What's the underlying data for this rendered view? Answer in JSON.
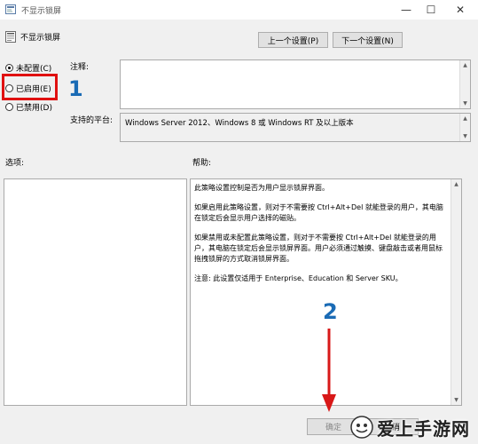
{
  "window": {
    "title": "不显示锁屏",
    "minimize_glyph": "—",
    "maximize_glyph": "☐",
    "close_glyph": "✕"
  },
  "header": {
    "policy_title": "不显示锁屏",
    "prev_button": "上一个设置(P)",
    "next_button": "下一个设置(N)"
  },
  "radios": {
    "not_configured": "未配置(C)",
    "enabled": "已启用(E)",
    "disabled": "已禁用(D)",
    "selected": "not_configured"
  },
  "comment": {
    "label": "注释:",
    "value": ""
  },
  "supported": {
    "label": "支持的平台:",
    "value": "Windows Server 2012、Windows 8 或 Windows RT 及以上版本"
  },
  "options_label": "选项:",
  "help": {
    "label": "帮助:",
    "paragraphs": [
      "此策略设置控制是否为用户显示锁屏界面。",
      "如果启用此策略设置，则对于不需要按 Ctrl+Alt+Del 就能登录的用户，其电脑在锁定后会显示用户选择的磁贴。",
      "如果禁用或未配置此策略设置，则对于不需要按 Ctrl+Alt+Del 就能登录的用户，其电脑在锁定后会显示锁屏界面。用户必须通过触摸、键盘敲击或者用鼠标拖拽锁屏的方式取消锁屏界面。",
      "注意: 此设置仅适用于 Enterprise、Education 和 Server SKU。"
    ]
  },
  "footer": {
    "ok_button": "确定",
    "cancel_button": "取消"
  },
  "annotations": {
    "marker1": "1",
    "marker2": "2",
    "highlight_color": "#e01010",
    "marker_color": "#1a6bb5"
  },
  "watermark": {
    "text": "爱上手游网"
  },
  "icons": {
    "title": "policy-icon",
    "header": "policy-setting-icon"
  }
}
